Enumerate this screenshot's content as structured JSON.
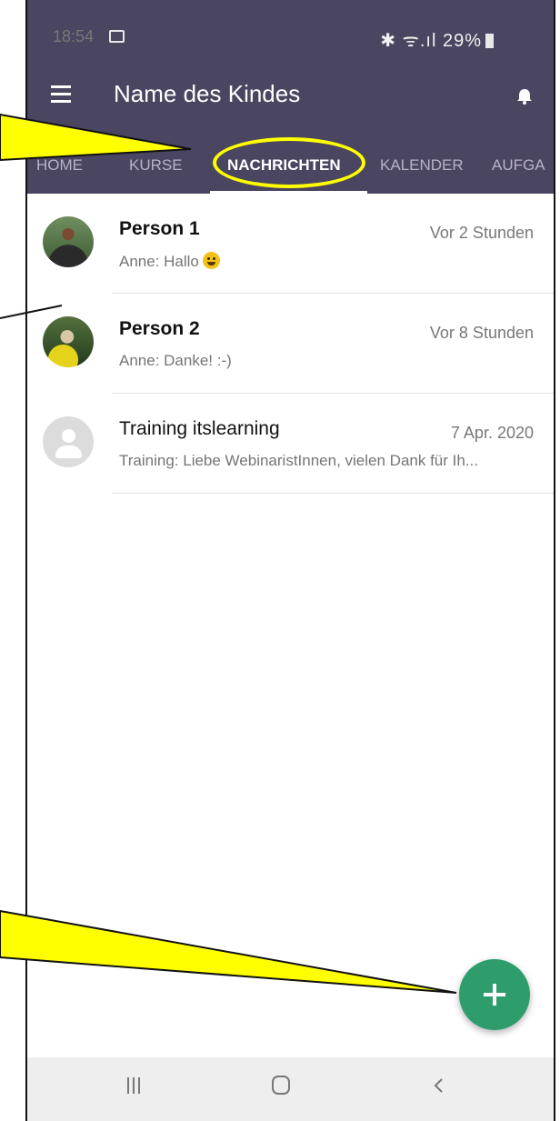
{
  "status_bar": {
    "time": "18:54",
    "right": "✱ ᯤ.ıl 29%"
  },
  "app_bar": {
    "title": "Name des Kindes"
  },
  "tabs": [
    {
      "label": "HOME",
      "active": false
    },
    {
      "label": "KURSE",
      "active": false
    },
    {
      "label": "NACHRICHTEN",
      "active": true
    },
    {
      "label": "KALENDER",
      "active": false
    },
    {
      "label": "AUFGA",
      "active": false
    }
  ],
  "messages": [
    {
      "name": "Person 1",
      "time": "Vor 2 Stunden",
      "preview": "Anne: Hallo"
    },
    {
      "name": "Person 2",
      "time": "Vor 8 Stunden",
      "preview": "Anne: Danke! :-)"
    },
    {
      "name": "Training itslearning",
      "time": "7 Apr. 2020",
      "preview": "Training: Liebe WebinaristInnen, vielen Dank für Ih..."
    }
  ],
  "colors": {
    "header": "#4a4560",
    "fab": "#2e9c6b",
    "callout": "#ffff00"
  },
  "icons": [
    "menu-icon",
    "bell-icon",
    "plus-icon",
    "image-icon",
    "bluetooth-icon",
    "wifi-icon",
    "signal-icon",
    "battery-icon"
  ]
}
